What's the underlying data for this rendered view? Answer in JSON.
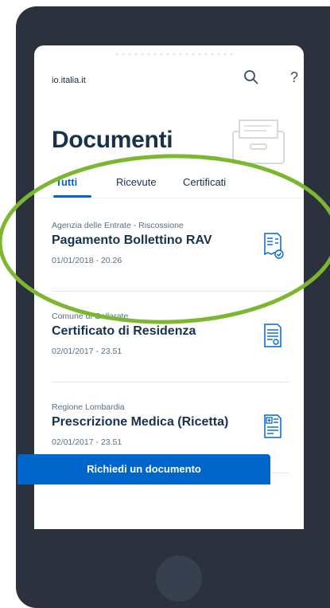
{
  "header": {
    "url": "io.italia.it",
    "search_icon": "search-icon",
    "help_label": "?"
  },
  "page": {
    "title": "Documenti"
  },
  "tabs": [
    {
      "label": "Tutti",
      "active": true
    },
    {
      "label": "Ricevute",
      "active": false
    },
    {
      "label": "Certificati",
      "active": false
    }
  ],
  "documents": [
    {
      "issuer": "Agenzia delle Entrate - Riscossione",
      "title": "Pagamento Bollettino RAV",
      "date": "01/01/2018 - 20.26",
      "icon": "receipt-check-icon"
    },
    {
      "issuer": "Comune di Gallarate",
      "title": "Certificato di Residenza",
      "date": "02/01/2017 - 23.51",
      "icon": "certificate-icon"
    },
    {
      "issuer": "Regione Lombardia",
      "title": "Prescrizione Medica (Ricetta)",
      "date": "02/01/2017 - 23.51",
      "icon": "prescription-icon"
    }
  ],
  "cta": {
    "label": "Richiedi un documento"
  },
  "colors": {
    "primary": "#0066cc",
    "title": "#17324d",
    "device_frame": "#2b313d",
    "highlight": "#7cb82f"
  }
}
